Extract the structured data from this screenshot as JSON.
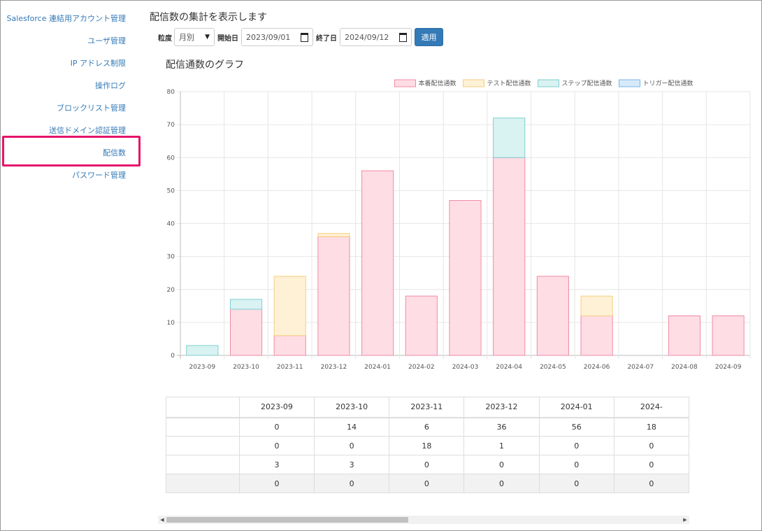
{
  "sidebar": {
    "items": [
      {
        "label": "Salesforce 連結用アカウント管理"
      },
      {
        "label": "ユーザ管理"
      },
      {
        "label": "IP アドレス制限"
      },
      {
        "label": "操作ログ"
      },
      {
        "label": "ブロックリスト管理"
      },
      {
        "label": "送信ドメイン認証管理"
      },
      {
        "label": "配信数",
        "selected": true
      },
      {
        "label": "パスワード管理"
      }
    ]
  },
  "header": {
    "title": "配信数の集計を表示します"
  },
  "filters": {
    "granularity_label": "粒度",
    "granularity_value": "月別",
    "start_label": "開始日",
    "start_value": "2023/09/01",
    "end_label": "終了日",
    "end_value": "2024/09/12",
    "apply_label": "適用"
  },
  "chart_title": "配信通数のグラフ",
  "chart_data": {
    "type": "bar",
    "stacked": true,
    "categories": [
      "2023-09",
      "2023-10",
      "2023-11",
      "2023-12",
      "2024-01",
      "2024-02",
      "2024-03",
      "2024-04",
      "2024-05",
      "2024-06",
      "2024-07",
      "2024-08",
      "2024-09"
    ],
    "series": [
      {
        "name": "本番配信通数",
        "values": [
          0,
          14,
          6,
          36,
          56,
          18,
          47,
          60,
          24,
          12,
          0,
          12,
          12
        ],
        "fill": "#ffdde5",
        "stroke": "#f28aa5"
      },
      {
        "name": "テスト配信通数",
        "values": [
          0,
          0,
          18,
          1,
          0,
          0,
          0,
          0,
          0,
          6,
          0,
          0,
          0
        ],
        "fill": "#fff1d6",
        "stroke": "#f5cf80"
      },
      {
        "name": "ステップ配信通数",
        "values": [
          3,
          3,
          0,
          0,
          0,
          0,
          0,
          12,
          0,
          0,
          0,
          0,
          0
        ],
        "fill": "#d9f2f2",
        "stroke": "#7fcfcf"
      },
      {
        "name": "トリガー配信通数",
        "values": [
          0,
          0,
          0,
          0,
          0,
          0,
          0,
          0,
          0,
          0,
          0,
          0,
          0
        ],
        "fill": "#d6eafa",
        "stroke": "#7bb6e6"
      }
    ],
    "ylim": [
      0,
      80
    ],
    "yticks": [
      0,
      10,
      20,
      30,
      40,
      50,
      60,
      70,
      80
    ],
    "grid": true,
    "legend": "top"
  },
  "table": {
    "headers": [
      "",
      "2023-09",
      "2023-10",
      "2023-11",
      "2023-12",
      "2024-01",
      "2024-"
    ],
    "rows": [
      [
        "",
        "0",
        "14",
        "6",
        "36",
        "56",
        "18"
      ],
      [
        "",
        "0",
        "0",
        "18",
        "1",
        "0",
        "0"
      ],
      [
        "",
        "3",
        "3",
        "0",
        "0",
        "0",
        "0"
      ],
      [
        "",
        "0",
        "0",
        "0",
        "0",
        "0",
        "0"
      ]
    ]
  }
}
